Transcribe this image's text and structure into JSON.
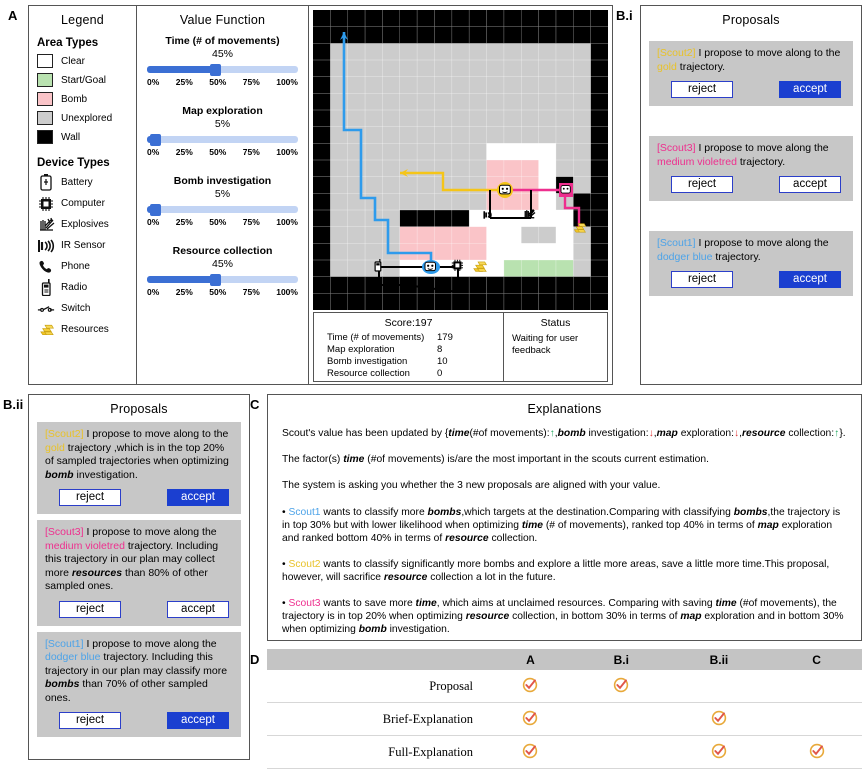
{
  "panels": {
    "a": "A",
    "bi": "B.i",
    "bii": "B.ii",
    "c": "C",
    "d": "D"
  },
  "legend": {
    "title": "Legend",
    "area_heading": "Area Types",
    "areas": [
      {
        "label": "Clear",
        "color": "#ffffff"
      },
      {
        "label": "Start/Goal",
        "color": "#b9e2b0"
      },
      {
        "label": "Bomb",
        "color": "#fac4c8"
      },
      {
        "label": "Unexplored",
        "color": "#cccccc"
      },
      {
        "label": "Wall",
        "color": "#000000"
      }
    ],
    "device_heading": "Device Types",
    "devices": [
      {
        "label": "Battery",
        "icon": "battery-icon"
      },
      {
        "label": "Computer",
        "icon": "computer-icon"
      },
      {
        "label": "Explosives",
        "icon": "explosives-icon"
      },
      {
        "label": "IR Sensor",
        "icon": "ir-sensor-icon"
      },
      {
        "label": "Phone",
        "icon": "phone-icon"
      },
      {
        "label": "Radio",
        "icon": "radio-icon"
      },
      {
        "label": "Switch",
        "icon": "switch-icon"
      },
      {
        "label": "Resources",
        "icon": "resources-icon"
      }
    ]
  },
  "value_function": {
    "title": "Value Function",
    "tick_labels": [
      "0%",
      "25%",
      "50%",
      "75%",
      "100%"
    ],
    "sliders": [
      {
        "name": "Time (# of movements)",
        "value_label": "45%",
        "value": 45
      },
      {
        "name": "Map exploration",
        "value_label": "5%",
        "value": 5
      },
      {
        "name": "Bomb investigation",
        "value_label": "5%",
        "value": 5
      },
      {
        "name": "Resource collection",
        "value_label": "45%",
        "value": 45
      }
    ],
    "colors": {
      "fill": "#3b6fd4",
      "track": "#c2d4f4"
    }
  },
  "map": {
    "score_title": "Score:197",
    "status_title": "Status",
    "status_text": "Waiting for user feedback",
    "stats": [
      {
        "name": "Time (# of movements)",
        "value": "179"
      },
      {
        "name": "Map exploration",
        "value": "8"
      },
      {
        "name": "Bomb investigation",
        "value": "10"
      },
      {
        "name": "Resource collection",
        "value": "0"
      }
    ],
    "trajectory_colors": {
      "scout1": "#2e9bec",
      "scout2": "#f5c518",
      "scout3": "#ee2f8e"
    }
  },
  "proposals_bi": {
    "title": "Proposals",
    "cards": [
      {
        "scout": "[Scout2]",
        "scout_color": "#e8c22a",
        "text_before": " I propose to move along to the ",
        "traj": "gold",
        "traj_color": "#e8c22a",
        "text_after": " trajectory.",
        "reject": "reject",
        "accept": "accept",
        "accept_selected": true
      },
      {
        "scout": "[Scout3]",
        "scout_color": "#ee2f8e",
        "text_before": " I propose to move along the ",
        "traj": "medium violetred",
        "traj_color": "#ee2f8e",
        "text_after": " trajectory.",
        "reject": "reject",
        "accept": "accept",
        "accept_selected": false
      },
      {
        "scout": "[Scout1]",
        "scout_color": "#4da3e8",
        "text_before": " I propose to move along the ",
        "traj": "dodger blue",
        "traj_color": "#4da3e8",
        "text_after": " trajectory.",
        "reject": "reject",
        "accept": "accept",
        "accept_selected": true
      }
    ]
  },
  "proposals_bii": {
    "title": "Proposals",
    "cards": [
      {
        "scout": "[Scout2]",
        "text_before": " I propose to move along to the ",
        "traj": "gold",
        "text_after": " trajectory ,which is in the top 20% of sampled trajectories when optimizing ",
        "emph": "bomb",
        "text_tail": " investigation.",
        "reject": "reject",
        "accept": "accept",
        "accept_selected": true
      },
      {
        "scout": "[Scout3]",
        "text_before": " I propose to move along the ",
        "traj": "medium violetred",
        "text_after": " trajectory. Including this trajectory in our plan may collect more ",
        "emph": "resources",
        "text_tail": " than 80% of other sampled ones.",
        "reject": "reject",
        "accept": "accept",
        "accept_selected": false
      },
      {
        "scout": "[Scout1]",
        "text_before": " I propose to move along the ",
        "traj": "dodger blue",
        "text_after": " trajectory. Including this trajectory in our plan may classify more ",
        "emph": "bombs",
        "text_tail": " than 70% of other sampled ones.",
        "reject": "reject",
        "accept": "accept",
        "accept_selected": true
      }
    ]
  },
  "explanations": {
    "title": "Explanations",
    "p1_a": "Scout's value has been updated by {",
    "p1_time": "time",
    "p1_b": "(#of movements):",
    "arrow_up": "↑",
    "arrow_down": "↓",
    "p1_c": ",",
    "p1_bomb": "bomb",
    "p1_d": " investigation:",
    "p1_e": ",",
    "p1_map": "map",
    "p1_f": " exploration:",
    "p1_g": ",",
    "p1_res": "resource",
    "p1_h": " collection:",
    "p1_i": "}.",
    "p2_a": "The factor(s) ",
    "p2_time": "time",
    "p2_b": " (#of movements) is/are the most important in the scouts current estimation.",
    "p3": "The system is asking you whether the 3 new proposals are aligned with your value.",
    "b1_bullet": "• ",
    "b1_scout": "Scout1",
    "b1_t1": " wants to classify more ",
    "b1_bombs1": "bombs",
    "b1_t2": ",which targets at the destination.Comparing with classifying ",
    "b1_bombs2": "bombs",
    "b1_t3": ",the trajectory is in top 30% but with lower likelihood when optimizing ",
    "b1_time": "time",
    "b1_t4": " (# of movements), ranked top 40% in terms of ",
    "b1_map": "map",
    "b1_t5": " exploration and ranked bottom 40% in terms of ",
    "b1_res": "resource",
    "b1_t6": " collection.",
    "b2_scout": "Scout2",
    "b2_t1": " wants to classify significantly more bombs and explore a little more areas, save a little more time.This proposal, however, will sacrifice ",
    "b2_res": "resource",
    "b2_t2": " collection a lot in the future.",
    "b3_scout": "Scout3",
    "b3_t1": " wants to save more ",
    "b3_time1": "time",
    "b3_t2": ", which aims at unclaimed resources. Comparing with saving ",
    "b3_time2": "time",
    "b3_t3": " (#of movements), the trajectory is in top 20% when optimizing ",
    "b3_res": "resource",
    "b3_t4": " collection, in bottom 30% in terms of ",
    "b3_map": "map",
    "b3_t5": " exploration and in bottom 30% when optimizing ",
    "b3_bomb": "bomb",
    "b3_t6": " investigation."
  },
  "comparison_table": {
    "columns": [
      "",
      "A",
      "B.i",
      "B.ii",
      "C"
    ],
    "rows": [
      {
        "label": "Proposal",
        "marks": [
          true,
          true,
          false,
          false
        ]
      },
      {
        "label": "Brief-Explanation",
        "marks": [
          true,
          false,
          true,
          false
        ]
      },
      {
        "label": "Full-Explanation",
        "marks": [
          true,
          false,
          true,
          true
        ]
      }
    ],
    "check_colors": {
      "ring": "#e8a93a",
      "tick": "#e0564a"
    }
  }
}
